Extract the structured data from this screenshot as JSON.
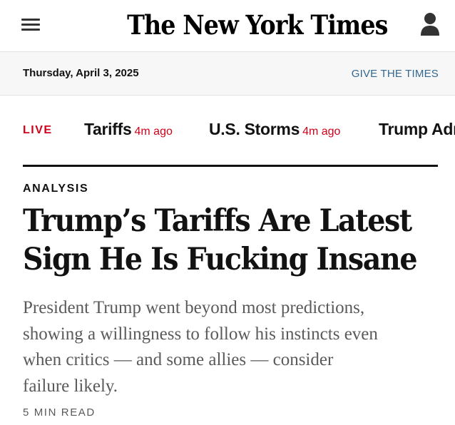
{
  "header": {
    "logo": "The New York Times",
    "menu_icon": "hamburger-menu-icon",
    "account_icon": "user-account-icon"
  },
  "datebar": {
    "date": "Thursday, April 3, 2025",
    "give_link": "GIVE THE TIMES"
  },
  "ticker": {
    "live_label": "LIVE",
    "items": [
      {
        "title": "Tariffs",
        "time": "4m ago"
      },
      {
        "title": "U.S. Storms",
        "time": "4m ago"
      },
      {
        "title": "Trump Adm",
        "time": ""
      }
    ]
  },
  "article": {
    "kicker": "ANALYSIS",
    "headline_lines": [
      "Trump’s Tariffs Are Latest",
      "Sign He Is Fucking Insane"
    ],
    "summary_lines": [
      "President Trump went beyond most predictions,",
      "showing a willingness to follow his instincts even",
      "when critics — and some allies — consider",
      "failure likely."
    ],
    "read_time": "5 MIN READ"
  },
  "colors": {
    "live_red": "#d0021b",
    "link_blue": "#326891",
    "summary_gray": "#5a5a5a"
  }
}
